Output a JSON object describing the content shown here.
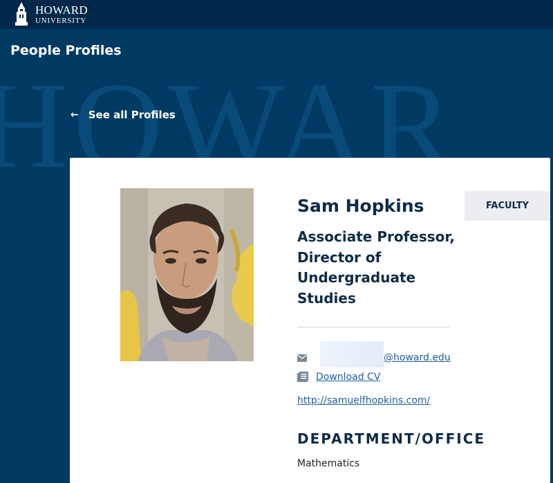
{
  "header": {
    "logo_line1": "HOWARD",
    "logo_line2": "UNIVERSITY",
    "logo_icon": "bell-tower-icon"
  },
  "banner": {
    "page_title": "People Profiles",
    "watermark_text": "HOWAR",
    "back_link": "See all Profiles"
  },
  "profile": {
    "name": "Sam Hopkins",
    "badge": "FACULTY",
    "title": "Associate Professor, Director of Undergraduate Studies",
    "email_domain": "@howard.edu",
    "cv_label": "Download CV",
    "website": "http://samuelfhopkins.com/",
    "department_heading": "DEPARTMENT/OFFICE",
    "department": "Mathematics"
  },
  "colors": {
    "banner_bg": "#003a63",
    "topbar_bg": "#00284a",
    "heading_navy": "#0f2b46",
    "link_blue": "#1f5e9c",
    "badge_bg": "#ebedf0"
  }
}
